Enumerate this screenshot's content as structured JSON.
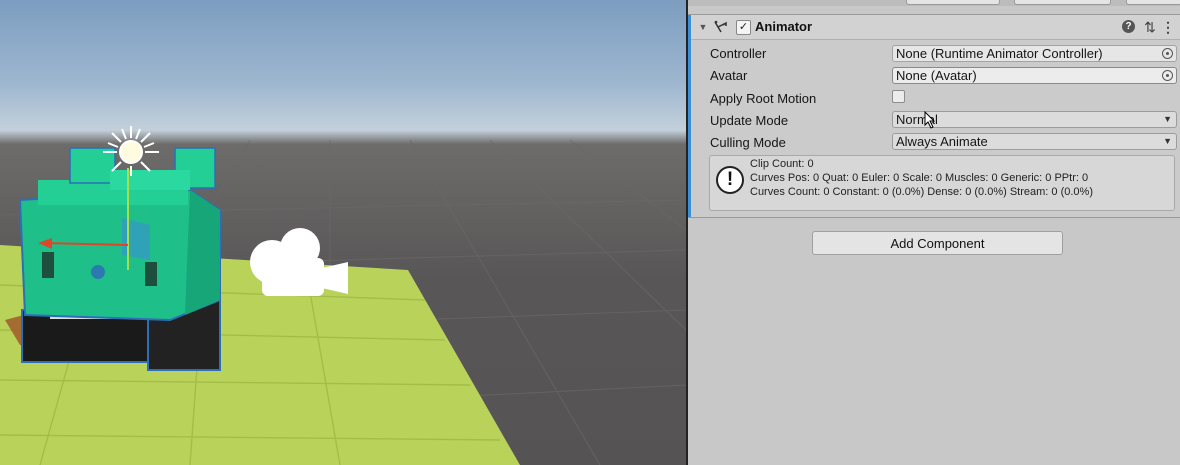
{
  "component": {
    "title": "Animator",
    "enabled": true,
    "foldout_icon": "foldout-arrow-icon",
    "component_icon": "animator-icon",
    "header_icons": [
      "help-icon",
      "preset-icon",
      "menu-icon"
    ]
  },
  "properties": [
    {
      "label": "Controller",
      "value": "None (Runtime Animator Controller)",
      "kind": "object-field"
    },
    {
      "label": "Avatar",
      "value": "None (Avatar)",
      "kind": "object-field"
    },
    {
      "label": "Apply Root Motion",
      "checked": false,
      "kind": "checkbox"
    },
    {
      "label": "Update Mode",
      "value": "Normal",
      "kind": "dropdown"
    },
    {
      "label": "Culling Mode",
      "value": "Always Animate",
      "kind": "dropdown"
    }
  ],
  "info": {
    "icon": "info-exclamation-icon",
    "lines": [
      "Clip Count: 0",
      "Curves Pos: 0 Quat: 0 Euler: 0 Scale: 0 Muscles: 0 Generic: 0 PPtr: 0",
      "Curves Count: 0 Constant: 0 (0.0%) Dense: 0 (0.0%) Stream: 0 (0.0%)"
    ]
  },
  "add_component_label": "Add Component",
  "scene": {
    "objects": [
      "robot-model",
      "light-gizmo-icon",
      "camera-gizmo-icon",
      "ground-plane"
    ],
    "colors": {
      "robot": "#1fbf8a",
      "ground": "#b9d25a",
      "accent": "#3a8fd6"
    }
  }
}
